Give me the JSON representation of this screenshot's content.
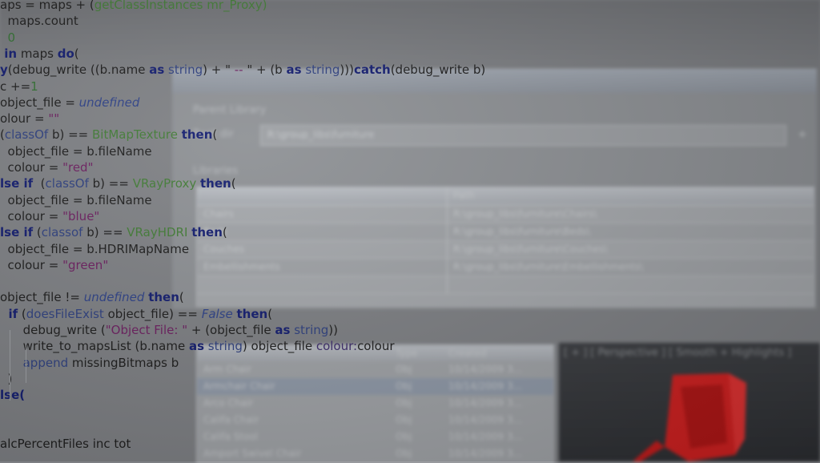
{
  "dialog": {
    "title": "",
    "label_library": "Parent Library",
    "label_root": "Root dir",
    "combo_value": "R:\\group_libs\\furniture",
    "label_libraries": "Libraries",
    "combo_button": "+",
    "table_header": [
      "",
      "Path"
    ],
    "table_rows": [
      [
        "Chairs",
        "R:\\group_libs\\furniture\\Chairs\\"
      ],
      [
        "Beds",
        "R:\\group_libs\\furniture\\Beds\\"
      ],
      [
        "Couches",
        "R:\\group_libs\\furniture\\Couches\\"
      ],
      [
        "Embellishments",
        "R:\\group_libs\\furniture\\Embellishments\\"
      ]
    ],
    "lower_header": [
      "",
      "Type",
      "Created"
    ],
    "lower_rows": [
      [
        "Arm Chair",
        "Obj",
        "10/14/2009 3..."
      ],
      [
        "Armchair Chair",
        "Obj",
        "10/14/2009 3..."
      ],
      [
        "Arco Chair",
        "Obj",
        "10/14/2009 3..."
      ],
      [
        "Califa Chair",
        "Obj",
        "10/14/2009 3..."
      ],
      [
        "Califa Stool",
        "Obj",
        "10/14/2009 3..."
      ],
      [
        "Amport Swivel Chair",
        "Obj",
        "10/14/2009 3..."
      ]
    ],
    "viewport_label": "[ + ] [ Perspective ] [ Smooth + Highlights ]"
  },
  "code": {
    "lines": [
      [
        [
          "aps = maps + (",
          ""
        ],
        [
          "getClassInstances",
          "cls"
        ],
        [
          " mr_Proxy)",
          "cls"
        ]
      ],
      [
        [
          "  maps.count",
          ""
        ]
      ],
      [
        [
          "  0",
          "num"
        ]
      ],
      [
        [
          " in",
          "kw"
        ],
        [
          " maps ",
          ""
        ],
        [
          "do",
          "kw"
        ],
        [
          "(",
          ""
        ]
      ],
      [
        [
          "y",
          "kw"
        ],
        [
          "(debug_write ((b.name ",
          ""
        ],
        [
          "as",
          "kw"
        ],
        [
          " string",
          "fn"
        ],
        [
          ") + \" ",
          ""
        ],
        [
          "--",
          "str"
        ],
        [
          " \" + (b ",
          ""
        ],
        [
          "as",
          "kw"
        ],
        [
          " string",
          "fn"
        ],
        [
          ")))",
          ""
        ],
        [
          "catch",
          "kw"
        ],
        [
          "(debug_write b)",
          ""
        ]
      ],
      [
        [
          "c +=",
          ""
        ],
        [
          "1",
          "num"
        ]
      ],
      [
        [
          "object_file = ",
          ""
        ],
        [
          "undefined",
          "it"
        ]
      ],
      [
        [
          "olour = ",
          ""
        ],
        [
          "\"\"",
          "str"
        ]
      ],
      [
        [
          "(",
          ""
        ],
        [
          "classOf",
          "fn"
        ],
        [
          " b) == ",
          ""
        ],
        [
          "BitMapTexture",
          "cls"
        ],
        [
          " ",
          ""
        ],
        [
          "then",
          "kw"
        ],
        [
          "(",
          ""
        ]
      ],
      [
        [
          "  object_file = b.fileName",
          ""
        ]
      ],
      [
        [
          "  colour = ",
          ""
        ],
        [
          "\"red\"",
          "str"
        ]
      ],
      [
        [
          "lse if",
          "kw"
        ],
        [
          "  (",
          ""
        ],
        [
          "classOf",
          "fn"
        ],
        [
          " b) == ",
          ""
        ],
        [
          "VRayProxy",
          "cls"
        ],
        [
          " ",
          ""
        ],
        [
          "then",
          "kw"
        ],
        [
          "(",
          ""
        ]
      ],
      [
        [
          "  object_file = b.fileName",
          ""
        ]
      ],
      [
        [
          "  colour = ",
          ""
        ],
        [
          "\"blue\"",
          "str"
        ]
      ],
      [
        [
          "lse if",
          "kw"
        ],
        [
          " (",
          ""
        ],
        [
          "classof",
          "fn"
        ],
        [
          " b) == ",
          ""
        ],
        [
          "VRayHDRI",
          "cls"
        ],
        [
          " ",
          ""
        ],
        [
          "then",
          "kw"
        ],
        [
          "(",
          ""
        ]
      ],
      [
        [
          "  object_file = b.HDRIMapName",
          ""
        ]
      ],
      [
        [
          "  colour = ",
          ""
        ],
        [
          "\"green\"",
          "str"
        ]
      ],
      [
        [
          "",
          ""
        ]
      ],
      [
        [
          "object_file != ",
          ""
        ],
        [
          "undefined",
          "it"
        ],
        [
          " ",
          ""
        ],
        [
          "then",
          "kw"
        ],
        [
          "(",
          ""
        ]
      ],
      [
        [
          "  if",
          "kw"
        ],
        [
          " (",
          ""
        ],
        [
          "doesFileExist",
          "fn"
        ],
        [
          " object_file) == ",
          ""
        ],
        [
          "False",
          "it"
        ],
        [
          " ",
          ""
        ],
        [
          "then",
          "kw"
        ],
        [
          "(",
          ""
        ]
      ],
      [
        [
          "      debug_write (",
          ""
        ],
        [
          "\"Object File: \"",
          "str"
        ],
        [
          " + (object_file ",
          ""
        ],
        [
          "as",
          "kw"
        ],
        [
          " string",
          "fn"
        ],
        [
          "))",
          ""
        ]
      ],
      [
        [
          "      write_to_mapsList (b.name ",
          ""
        ],
        [
          "as",
          "kw"
        ],
        [
          " string",
          "fn"
        ],
        [
          ") object_file ",
          ""
        ],
        [
          "colour:",
          "prop"
        ],
        [
          "colour",
          ""
        ]
      ],
      [
        [
          "      append",
          "fn"
        ],
        [
          " missingBitmaps b",
          ""
        ]
      ],
      [
        [
          "  )",
          ""
        ]
      ],
      [
        [
          "lse(",
          "kw"
        ]
      ],
      [
        [
          "",
          ""
        ]
      ],
      [
        [
          "",
          ""
        ]
      ],
      [
        [
          "alcPercentFiles inc tot",
          ""
        ]
      ]
    ]
  }
}
